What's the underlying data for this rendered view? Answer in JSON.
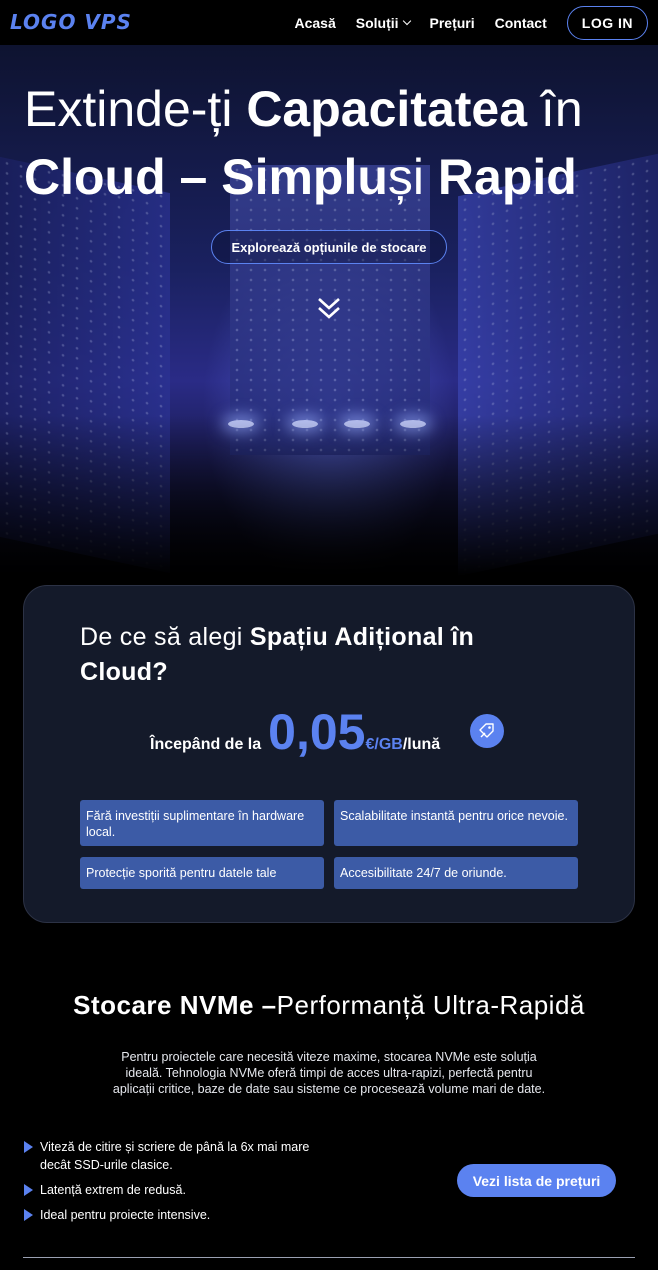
{
  "header": {
    "logo": "LOGO VPS",
    "nav": [
      {
        "label": "Acasă"
      },
      {
        "label": "Soluții"
      },
      {
        "label": "Prețuri"
      },
      {
        "label": "Contact"
      }
    ],
    "login_label": "LOG IN"
  },
  "hero": {
    "title_1": "Extinde-ți ",
    "title_2": "Capacitatea",
    "title_3": " în",
    "title_4": "Cloud – Simplu",
    "title_5": "și ",
    "title_6": "Rapid",
    "explore_label": "Explorează opțiunile de stocare",
    "scroll_icon": "double-chevron-down-icon"
  },
  "card": {
    "title_light": "De ce să alegi ",
    "title_bold": "Spațiu Adițional în Cloud?",
    "from_label": "Începând de la",
    "amount": "0,05",
    "unit": "€/GB",
    "per": "/lună",
    "tag_icon": "price-tag-icon",
    "features": [
      "Fără investiții suplimentare în hardware local.",
      "Scalabilitate instantă pentru orice nevoie.",
      "Protecție sporită pentru datele tale",
      "Accesibilitate 24/7 de oriunde."
    ]
  },
  "nvme": {
    "title_bold": "Stocare NVMe –",
    "title_light": "Performanță Ultra-Rapidă",
    "description": "Pentru proiectele care necesită viteze maxime, stocarea NVMe este soluția ideală. Tehnologia NVMe oferă timpi de acces ultra-rapizi, perfectă pentru aplicații critice, baze de date sau sisteme ce procesează volume mari de date.",
    "bullets": [
      "Viteză de citire și scriere de până la 6x mai mare decât SSD-urile clasice.",
      "Latență extrem de redusă.",
      "Ideal pentru proiecte intensive."
    ],
    "button_label": "Vezi lista de prețuri"
  },
  "colors": {
    "accent": "#5b82f0",
    "feature_bg": "#3c5ba6",
    "card_bg": "#141a2a"
  }
}
